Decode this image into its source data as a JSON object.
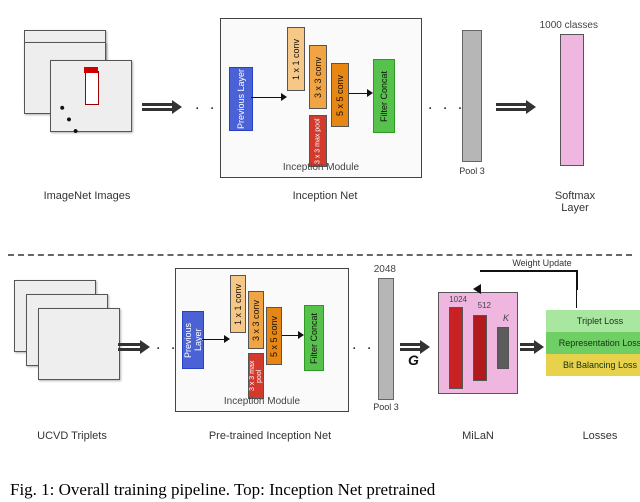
{
  "caption": "Fig. 1: Overall training pipeline. Top: Inception Net pretrained",
  "top": {
    "images_label": "ImageNet Images",
    "inception_label": "Inception Net",
    "softmax_label": "Softmax Layer",
    "classes": "1000 classes",
    "module_title": "Inception Module",
    "prev_layer": "Previous Layer",
    "conv1": "1 x 1 conv",
    "conv3": "3 x 3 conv",
    "conv5": "5 x 5 conv",
    "maxpool": "3 x 3 max pool",
    "concat": "Filter Concat",
    "pool3": "Pool 3"
  },
  "bottom": {
    "images_label": "UCVD Triplets",
    "inception_label": "Pre-trained Inception Net",
    "module_title": "Inception Module",
    "prev_layer": "Previous Layer",
    "conv1": "1 x 1 conv",
    "conv3": "3 x 3 conv",
    "conv5": "5 x 5 conv",
    "maxpool": "3 x 3 max pool",
    "concat": "Filter Concat",
    "pool3": "Pool 3",
    "pool_dim": "2048",
    "G": "G",
    "milan_label": "MiLaN",
    "milan_dim1": "1024",
    "milan_dim2": "512",
    "milan_dimK": "K",
    "weight_update": "Weight Update",
    "losses_label": "Losses",
    "loss_triplet": "Triplet Loss",
    "loss_repr": "Representation Loss",
    "loss_bit": "Bit Balancing Loss"
  }
}
